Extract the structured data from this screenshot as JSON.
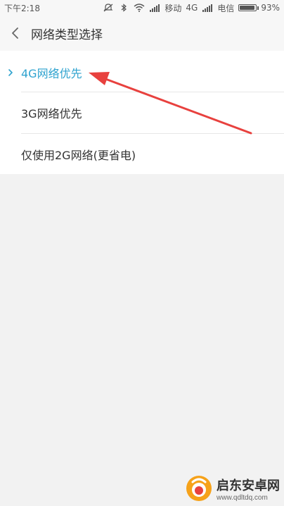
{
  "status_bar": {
    "time": "下午2:18",
    "carrier1": "移动",
    "network": "4G",
    "carrier2": "电信",
    "battery_percent": "93%",
    "battery_level": 93
  },
  "header": {
    "title": "网络类型选择"
  },
  "options": [
    {
      "label": "4G网络优先",
      "selected": true
    },
    {
      "label": "3G网络优先",
      "selected": false
    },
    {
      "label": "仅使用2G网络(更省电)",
      "selected": false
    }
  ],
  "icons": {
    "back": "chevron-left-icon",
    "selected_check": "chevron-right-icon"
  },
  "colors": {
    "accent": "#2fa3cf",
    "annotation_arrow": "#e8413e",
    "background": "#f2f2f2",
    "card": "#ffffff"
  },
  "watermark": {
    "name": "启东安卓网",
    "url": "www.qdltdq.com"
  }
}
